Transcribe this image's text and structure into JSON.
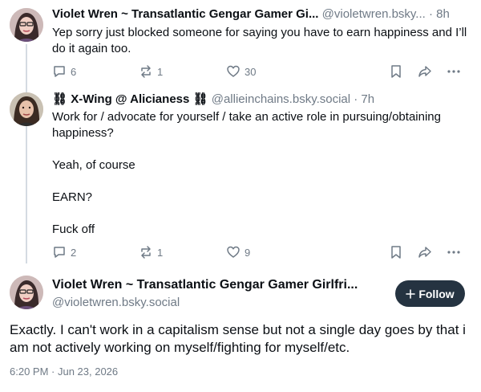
{
  "colors": {
    "accent_dark": "#253341",
    "muted": "#6f7a86",
    "thread_line": "#d4dbe2"
  },
  "post1": {
    "name": "Violet Wren ~ Transatlantic Gengar Gamer Gi...",
    "handle_time": "@violetwren.bsky... · 8h",
    "text": "Yep sorry just blocked someone for saying you have to earn happiness and I’ll do it again too.",
    "replies": "6",
    "reposts": "1",
    "likes": "30"
  },
  "post2": {
    "name": "⛓ X-Wing @ Alicianess ⛓",
    "handle_time": "@allieinchains.bsky.social · 7h",
    "text": "Work for / advocate for yourself / take an active role in pursuing/obtaining happiness?\n\nYeah, of course\n\nEARN?\n\nFuck off",
    "replies": "2",
    "reposts": "1",
    "likes": "9"
  },
  "main": {
    "name": "Violet Wren ~ Transatlantic Gengar Gamer Girlfri...",
    "handle": "@violetwren.bsky.social",
    "follow_label": "Follow",
    "text": "Exactly. I can't work in a capitalism sense but not a single day goes by that i am not actively working on myself/fighting for myself/etc.",
    "timestamp": "6:20 PM · Jun 23, 2026"
  },
  "icons": [
    "reply-icon",
    "repost-icon",
    "like-icon",
    "bookmark-icon",
    "share-icon",
    "more-icon",
    "plus-icon"
  ]
}
